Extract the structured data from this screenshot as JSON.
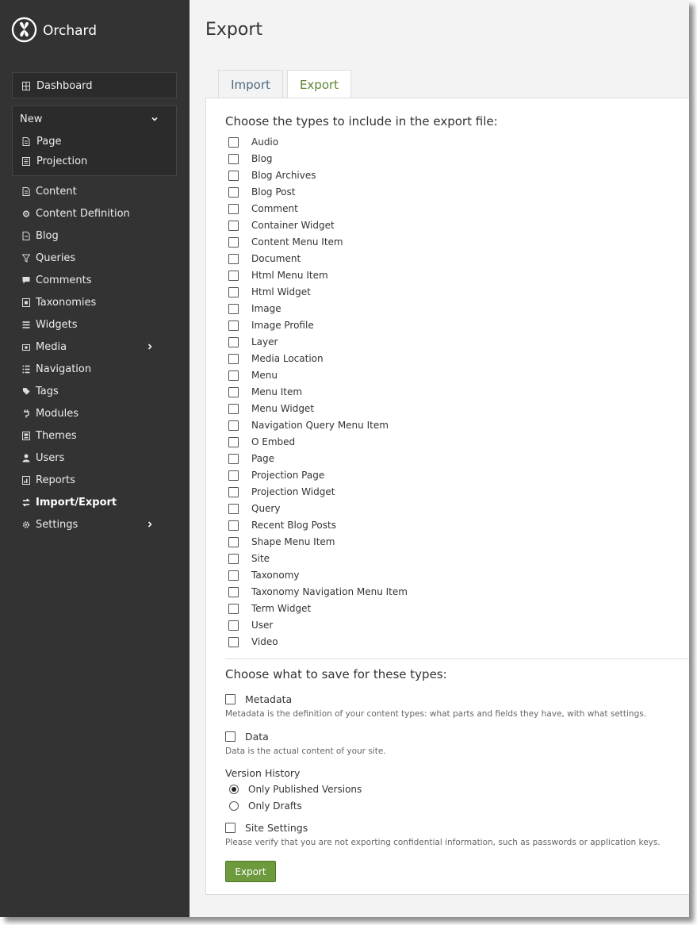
{
  "brand": {
    "name": "Orchard"
  },
  "nav": {
    "dashboard": "Dashboard",
    "new": {
      "label": "New",
      "items": [
        "Page",
        "Projection"
      ]
    },
    "items": [
      {
        "label": "Content",
        "icon": "content-icon"
      },
      {
        "label": "Content Definition",
        "icon": "content-definition-icon"
      },
      {
        "label": "Blog",
        "icon": "blog-icon"
      },
      {
        "label": "Queries",
        "icon": "filter-icon"
      },
      {
        "label": "Comments",
        "icon": "comment-icon"
      },
      {
        "label": "Taxonomies",
        "icon": "taxonomy-icon"
      },
      {
        "label": "Widgets",
        "icon": "widgets-icon"
      },
      {
        "label": "Media",
        "icon": "media-icon"
      },
      {
        "label": "Navigation",
        "icon": "navigation-icon"
      },
      {
        "label": "Tags",
        "icon": "tag-icon"
      },
      {
        "label": "Modules",
        "icon": "plug-icon"
      },
      {
        "label": "Themes",
        "icon": "themes-icon"
      },
      {
        "label": "Users",
        "icon": "user-icon"
      },
      {
        "label": "Reports",
        "icon": "reports-icon"
      },
      {
        "label": "Import/Export",
        "icon": "import-export-icon"
      },
      {
        "label": "Settings",
        "icon": "gear-icon"
      }
    ]
  },
  "page": {
    "title": "Export"
  },
  "tabs": {
    "import": "Import",
    "export": "Export"
  },
  "export": {
    "types_heading": "Choose the types to include in the export file:",
    "types": [
      "Audio",
      "Blog",
      "Blog Archives",
      "Blog Post",
      "Comment",
      "Container Widget",
      "Content Menu Item",
      "Document",
      "Html Menu Item",
      "Html Widget",
      "Image",
      "Image Profile",
      "Layer",
      "Media Location",
      "Menu",
      "Menu Item",
      "Menu Widget",
      "Navigation Query Menu Item",
      "O Embed",
      "Page",
      "Projection Page",
      "Projection Widget",
      "Query",
      "Recent Blog Posts",
      "Shape Menu Item",
      "Site",
      "Taxonomy",
      "Taxonomy Navigation Menu Item",
      "Term Widget",
      "User",
      "Video"
    ],
    "save_heading": "Choose what to save for these types:",
    "metadata_label": "Metadata",
    "metadata_hint": "Metadata is the definition of your content types: what parts and fields they have, with what settings.",
    "data_label": "Data",
    "data_hint": "Data is the actual content of your site.",
    "version_history_label": "Version History",
    "version_options": [
      "Only Published Versions",
      "Only Drafts"
    ],
    "site_settings_label": "Site Settings",
    "site_settings_hint": "Please verify that you are not exporting confidential information, such as passwords or application keys.",
    "button_label": "Export"
  }
}
